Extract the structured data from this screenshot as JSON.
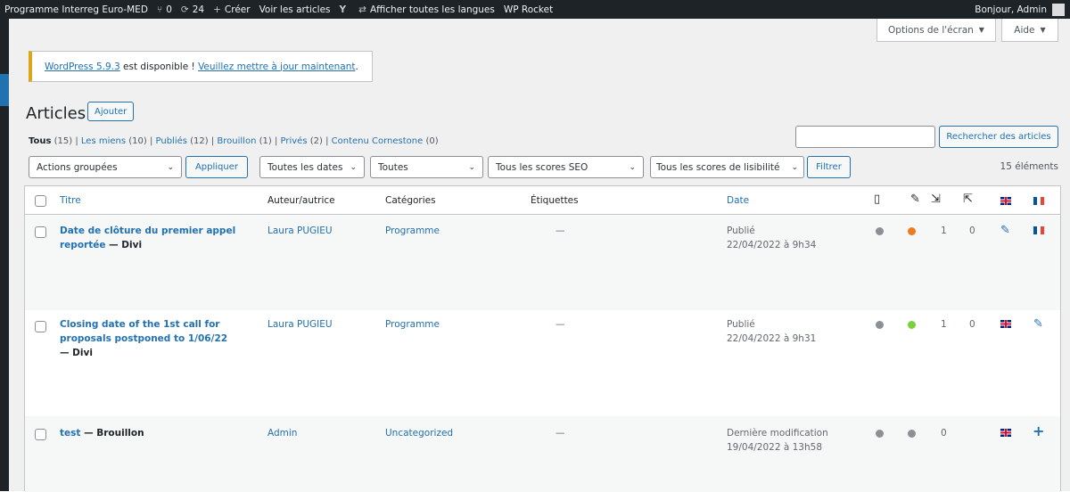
{
  "adminbar": {
    "site_name": "Programme Interreg Euro-MED",
    "revisions_count": "0",
    "updates_count": "24",
    "create_label": "Créer",
    "view_posts_label": "Voir les articles",
    "languages_label": "Afficher toutes les langues",
    "wp_rocket_label": "WP Rocket",
    "greeting": "Bonjour, Admin"
  },
  "screen_tabs": {
    "options_label": "Options de l'écran",
    "help_label": "Aide"
  },
  "notice": {
    "version_link": "WordPress 5.9.3",
    "text": " est disponible ! ",
    "update_link": "Veuillez mettre à jour maintenant",
    "end": "."
  },
  "page": {
    "title": "Articles",
    "add_button": "Ajouter"
  },
  "subsubsub": {
    "all_label": "Tous",
    "all_count": "(15)",
    "mine_label": "Les miens",
    "mine_count": "(10)",
    "published_label": "Publiés",
    "published_count": "(12)",
    "draft_label": "Brouillon",
    "draft_count": "(1)",
    "private_label": "Privés",
    "private_count": "(2)",
    "cornerstone_label": "Contenu Cornestone",
    "cornerstone_count": "(0)"
  },
  "search": {
    "value": "",
    "button": "Rechercher des articles"
  },
  "filters": {
    "bulk_actions": "Actions groupées",
    "apply": "Appliquer",
    "dates": "Toutes les dates",
    "categories": "Toutes",
    "seo_scores": "Tous les scores SEO",
    "readability_scores": "Tous les scores de lisibilité",
    "filter_button": "Filtrer",
    "items_count": "15 éléments"
  },
  "columns": {
    "title": "Titre",
    "author": "Auteur/autrice",
    "categories": "Catégories",
    "tags": "Étiquettes",
    "date": "Date"
  },
  "rows": [
    {
      "title": "Date de clôture du premier appel reportée",
      "state": " — Divi",
      "author": "Laura PUGIEU",
      "category": "Programme",
      "tags": "—",
      "date_status": "Publié",
      "date": "22/04/2022 à 9h34",
      "seo_color": "#8c8f94",
      "readability_color": "#ee7c1b",
      "incoming_links": "1",
      "outgoing_links": "0"
    },
    {
      "title": "Closing date of the 1st call for proposals postponed to 1/06/22",
      "state": " — Divi",
      "author": "Laura PUGIEU",
      "category": "Programme",
      "tags": "—",
      "date_status": "Publié",
      "date": "22/04/2022 à 9h31",
      "seo_color": "#8c8f94",
      "readability_color": "#7ad03a",
      "incoming_links": "1",
      "outgoing_links": "0"
    },
    {
      "title": "test",
      "state": " — Brouillon",
      "author": "Admin",
      "category": "Uncategorized",
      "tags": "—",
      "date_status": "Dernière modification",
      "date": "19/04/2022 à 13h58",
      "seo_color": "#8c8f94",
      "readability_color": "#8c8f94",
      "incoming_links": "0",
      "outgoing_links": ""
    }
  ],
  "colors": {
    "accent": "#2271b1",
    "adminbar": "#1d2327",
    "notice_warning": "#dba617"
  },
  "icons": {
    "revisions": "branch-icon",
    "updates": "refresh-icon",
    "create": "plus-icon",
    "yoast": "yoast-icon",
    "languages": "translate-icon",
    "seo_col": "seo-score-icon",
    "readability_col": "feather-icon",
    "incoming_col": "incoming-links-icon",
    "outgoing_col": "outgoing-links-icon",
    "edit": "pencil-icon",
    "add_translation": "plus-icon"
  }
}
